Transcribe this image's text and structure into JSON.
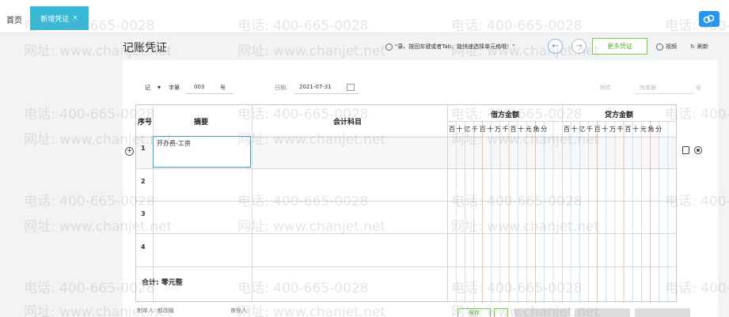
{
  "tabs": {
    "home": "首页",
    "active": "新增凭证",
    "close": "×"
  },
  "title": "记账凭证",
  "toolbar": {
    "hint": "\"录、按回车键或者Tab，能快速选择单元格哦！\"",
    "more_button": "更多凭证",
    "video": "视频",
    "refresh": "刷新"
  },
  "meta": {
    "voucher_word": "记",
    "zi_label": "字第",
    "number": "003",
    "hao_label": "号",
    "date_label": "日期:",
    "date": "2021-07-31",
    "attachment_label": "附件",
    "bills_label": "附单据",
    "zhang_label": "张"
  },
  "table": {
    "headers": {
      "index": "序号",
      "summary": "摘要",
      "account": "会计科目",
      "debit": "借方金额",
      "credit": "贷方金额"
    },
    "digits": [
      "百",
      "十",
      "亿",
      "千",
      "百",
      "十",
      "万",
      "千",
      "百",
      "十",
      "元",
      "角",
      "分"
    ],
    "rows": [
      {
        "index": "1",
        "summary": "开办费-工资"
      },
      {
        "index": "2",
        "summary": ""
      },
      {
        "index": "3",
        "summary": ""
      },
      {
        "index": "4",
        "summary": ""
      }
    ],
    "total": "合计:  零元整"
  },
  "footer": {
    "maker": "制单人: 都改编",
    "auditor": "审核人:",
    "save": "保存"
  },
  "watermark": {
    "phone": "电话: 400-665-0028",
    "site": "网址: www.chanjet.net"
  },
  "colors": {
    "tab_active": "#37b8d6",
    "accent_green": "#7ec850",
    "cell_focus": "#37a3be"
  }
}
